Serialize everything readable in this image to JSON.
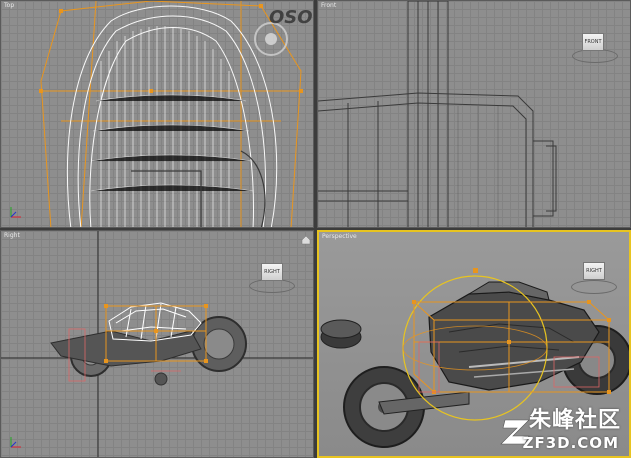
{
  "viewports": {
    "top": {
      "label": "Top"
    },
    "front": {
      "label": "Front",
      "cube_label": "FRONT"
    },
    "right": {
      "label": "Right",
      "cube_label": "RIGHT"
    },
    "perspective": {
      "label": "Perspective",
      "cube_label": "RIGHT"
    }
  },
  "watermark": {
    "text": "OSO"
  },
  "logo": {
    "main": "朱峰社区",
    "sub": "ZF3D.COM"
  },
  "colors": {
    "viewport_bg": "#8e8e8e",
    "active_border": "#e8c420",
    "wire_white": "#ffffff",
    "wire_orange": "#e8951e",
    "wire_dark": "#3a3a3a"
  }
}
